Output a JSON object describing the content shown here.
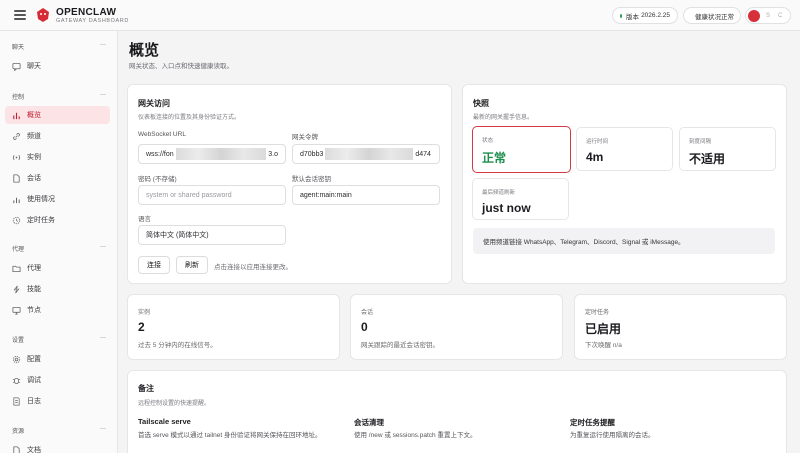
{
  "header": {
    "brand_title": "OPENCLAW",
    "brand_subtitle": "GATEWAY DASHBOARD",
    "version_label": "版本",
    "version_value": "2026.2.25",
    "health_label": "健康状况",
    "health_value": "正常",
    "icon_a": "S",
    "icon_b": "C"
  },
  "sidebar": {
    "sections": [
      {
        "title": "聊天",
        "items": [
          {
            "label": "聊天",
            "icon": "chat-icon"
          }
        ]
      },
      {
        "title": "控制",
        "items": [
          {
            "label": "概览",
            "icon": "chart-icon",
            "active": true
          },
          {
            "label": "频道",
            "icon": "link-icon"
          },
          {
            "label": "实例",
            "icon": "radio-icon"
          },
          {
            "label": "会话",
            "icon": "file-icon"
          },
          {
            "label": "使用情况",
            "icon": "bars-icon"
          },
          {
            "label": "定时任务",
            "icon": "clock-icon"
          }
        ]
      },
      {
        "title": "代理",
        "items": [
          {
            "label": "代理",
            "icon": "folder-icon"
          },
          {
            "label": "技能",
            "icon": "bolt-icon"
          },
          {
            "label": "节点",
            "icon": "monitor-icon"
          }
        ]
      },
      {
        "title": "设置",
        "items": [
          {
            "label": "配置",
            "icon": "gear-icon"
          },
          {
            "label": "调试",
            "icon": "bug-icon"
          },
          {
            "label": "日志",
            "icon": "log-icon"
          }
        ]
      },
      {
        "title": "资源",
        "items": [
          {
            "label": "文档",
            "icon": "doc-icon"
          }
        ]
      }
    ]
  },
  "page": {
    "title": "概览",
    "subtitle": "网关状态、入口点和快速健康读取。"
  },
  "gateway": {
    "title": "网关访问",
    "subtitle": "仪表板连接的位置及其身份验证方式。",
    "ws_label": "WebSocket URL",
    "ws_prefix": "wss://fon",
    "ws_suffix": "3.o",
    "token_label": "网关令牌",
    "token_prefix": "d70bb3",
    "token_suffix": "d474",
    "password_label": "密码 (不存储)",
    "password_placeholder": "system or shared password",
    "session_label": "默认会话密钥",
    "session_value": "agent:main:main",
    "lang_label": "语言",
    "lang_value": "简体中文 (简体中文)",
    "connect_btn": "连接",
    "refresh_btn": "刷新",
    "hint": "点击连接以应用连接更改。"
  },
  "snapshot": {
    "title": "快照",
    "subtitle": "最新的网关握手信息。",
    "stats": [
      {
        "label": "状态",
        "value": "正常"
      },
      {
        "label": "运行时间",
        "value": "4m"
      },
      {
        "label": "刻度间隔",
        "value": "不适用"
      },
      {
        "label": "最后频道刷新",
        "value": "just now"
      }
    ],
    "note": "使用频道链接 WhatsApp、Telegram、Discord、Signal 或 iMessage。"
  },
  "metrics": [
    {
      "label": "实例",
      "value": "2",
      "sub": "过去 5 分钟内的在线信号。"
    },
    {
      "label": "会话",
      "value": "0",
      "sub": "网关跟踪的最近会话密钥。"
    },
    {
      "label": "定时任务",
      "value": "已启用",
      "sub": "下次唤醒 n/a"
    }
  ],
  "notes": {
    "title": "备注",
    "subtitle": "远程控制设置的快速提醒。",
    "items": [
      {
        "title": "Tailscale serve",
        "text": "首选 serve 模式以通过 tailnet 身份验证将网关保持在回环地址。"
      },
      {
        "title": "会话清理",
        "text": "使用 /new 或 sessions.patch 重置上下文。"
      },
      {
        "title": "定时任务提醒",
        "text": "为重复运行使用隔离的会话。"
      }
    ]
  },
  "colors": {
    "accent": "#c2202f",
    "ok": "#1f8f4e",
    "highlight_border": "#d43a45"
  }
}
